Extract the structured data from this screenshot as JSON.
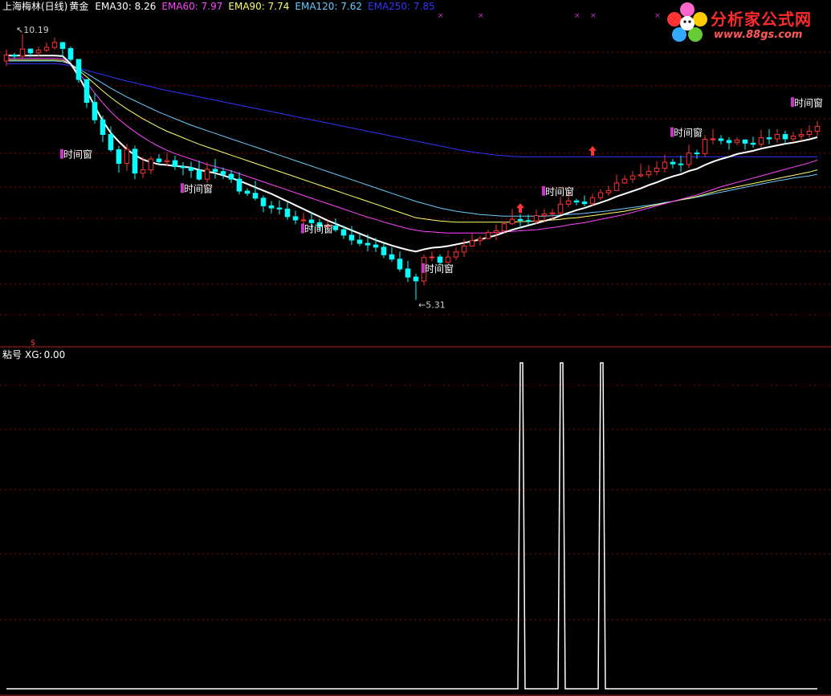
{
  "chart_data": [
    {
      "type": "candlestick",
      "header": {
        "title": "上海梅林(日线)",
        "indicator_name": "黄金",
        "ema_labels": [
          {
            "label": "EMA30:",
            "value": "8.26",
            "color": "#ffffff"
          },
          {
            "label": "EMA60:",
            "value": "7.97",
            "color": "#ff44ff"
          },
          {
            "label": "EMA90:",
            "value": "7.74",
            "color": "#ffff66"
          },
          {
            "label": "EMA120:",
            "value": "7.62",
            "color": "#66ccff"
          },
          {
            "label": "EMA250:",
            "value": "7.85",
            "color": "#3333ff"
          }
        ]
      },
      "ylim": [
        4.7,
        10.6
      ],
      "high_label": "10.19",
      "low_label": "←5.31",
      "signal_label": "时间窗",
      "signals": [
        {
          "i": 7,
          "y": 7.95
        },
        {
          "i": 22,
          "y": 7.32
        },
        {
          "i": 37,
          "y": 6.58
        },
        {
          "i": 52,
          "y": 5.85
        },
        {
          "i": 67,
          "y": 7.27
        },
        {
          "i": 83,
          "y": 8.35
        },
        {
          "i": 98,
          "y": 8.9
        }
      ],
      "up_arrows": [
        {
          "i": 64,
          "y": 7.0
        },
        {
          "i": 73,
          "y": 8.05
        }
      ],
      "x_marks": [
        54,
        59,
        71,
        73,
        81
      ],
      "candles": {
        "o": [
          9.7,
          9.81,
          9.79,
          9.92,
          9.85,
          9.9,
          9.95,
          10.04,
          9.93,
          9.73,
          9.36,
          8.94,
          8.62,
          8.35,
          8.07,
          7.82,
          8.08,
          7.64,
          7.7,
          7.9,
          7.85,
          7.87,
          7.76,
          7.74,
          7.69,
          7.53,
          7.71,
          7.67,
          7.62,
          7.53,
          7.31,
          7.27,
          7.18,
          7.04,
          7.0,
          6.98,
          6.84,
          6.78,
          6.78,
          6.73,
          6.66,
          6.67,
          6.6,
          6.5,
          6.41,
          6.35,
          6.32,
          6.28,
          6.14,
          6.06,
          5.88,
          5.73,
          5.66,
          6.09,
          6.1,
          6.0,
          6.1,
          6.19,
          6.3,
          6.4,
          6.44,
          6.55,
          6.58,
          6.71,
          6.79,
          6.77,
          6.76,
          6.86,
          6.89,
          6.91,
          7.07,
          7.13,
          7.11,
          7.08,
          7.19,
          7.28,
          7.32,
          7.46,
          7.53,
          7.59,
          7.61,
          7.67,
          7.73,
          7.84,
          7.81,
          7.8,
          8.01,
          8.0,
          8.26,
          8.27,
          8.24,
          8.2,
          8.25,
          8.19,
          8.17,
          8.29,
          8.27,
          8.35,
          8.27,
          8.32,
          8.35,
          8.41
        ],
        "c": [
          9.81,
          9.79,
          9.92,
          9.85,
          9.9,
          9.95,
          10.04,
          9.93,
          9.73,
          9.36,
          8.94,
          8.62,
          8.35,
          8.07,
          7.82,
          8.08,
          7.64,
          7.7,
          7.9,
          7.85,
          7.87,
          7.76,
          7.74,
          7.69,
          7.53,
          7.71,
          7.67,
          7.62,
          7.53,
          7.31,
          7.27,
          7.18,
          7.04,
          7.0,
          6.98,
          6.84,
          6.78,
          6.78,
          6.73,
          6.66,
          6.67,
          6.6,
          6.5,
          6.41,
          6.35,
          6.32,
          6.28,
          6.14,
          6.06,
          5.88,
          5.73,
          5.66,
          6.09,
          6.1,
          6.0,
          6.1,
          6.19,
          6.3,
          6.4,
          6.44,
          6.55,
          6.58,
          6.71,
          6.79,
          6.77,
          6.76,
          6.86,
          6.89,
          6.91,
          7.07,
          7.13,
          7.11,
          7.08,
          7.19,
          7.28,
          7.32,
          7.46,
          7.53,
          7.59,
          7.61,
          7.67,
          7.73,
          7.84,
          7.81,
          7.8,
          8.01,
          8.0,
          8.26,
          8.27,
          8.24,
          8.2,
          8.25,
          8.19,
          8.17,
          8.29,
          8.27,
          8.35,
          8.27,
          8.32,
          8.35,
          8.41,
          8.5
        ],
        "h": [
          9.91,
          9.85,
          10.19,
          9.91,
          9.96,
          10.04,
          10.13,
          10.01,
          9.97,
          9.64,
          9.2,
          9.1,
          8.7,
          8.5,
          8.14,
          8.18,
          8.15,
          7.94,
          7.95,
          7.99,
          8.02,
          7.96,
          7.84,
          7.85,
          7.87,
          7.84,
          7.9,
          7.74,
          7.7,
          7.66,
          7.36,
          7.5,
          7.23,
          7.13,
          7.14,
          7.1,
          6.95,
          6.91,
          6.92,
          6.8,
          6.77,
          6.81,
          6.68,
          6.67,
          6.53,
          6.52,
          6.45,
          6.36,
          6.28,
          6.2,
          6.03,
          5.79,
          6.15,
          6.2,
          6.15,
          6.22,
          6.27,
          6.43,
          6.53,
          6.49,
          6.6,
          6.7,
          6.75,
          6.98,
          6.89,
          6.88,
          6.97,
          6.98,
          6.98,
          7.2,
          7.31,
          7.17,
          7.23,
          7.26,
          7.35,
          7.41,
          7.61,
          7.6,
          7.68,
          7.81,
          7.79,
          7.86,
          7.98,
          7.9,
          7.96,
          8.16,
          8.07,
          8.34,
          8.45,
          8.34,
          8.3,
          8.3,
          8.26,
          8.31,
          8.43,
          8.45,
          8.45,
          8.42,
          8.4,
          8.46,
          8.52,
          8.6
        ],
        "l": [
          9.61,
          9.74,
          9.75,
          9.78,
          9.78,
          9.86,
          9.91,
          9.77,
          9.69,
          9.3,
          8.84,
          8.55,
          8.21,
          8.03,
          7.65,
          7.68,
          7.53,
          7.55,
          7.62,
          7.79,
          7.77,
          7.7,
          7.6,
          7.55,
          7.5,
          7.46,
          7.54,
          7.53,
          7.46,
          7.25,
          7.22,
          7.14,
          6.92,
          6.9,
          6.88,
          6.78,
          6.7,
          6.69,
          6.6,
          6.59,
          6.6,
          6.56,
          6.43,
          6.32,
          6.3,
          6.2,
          6.19,
          6.08,
          6.01,
          5.83,
          5.64,
          5.31,
          5.58,
          6.02,
          5.96,
          5.98,
          6.04,
          6.1,
          6.29,
          6.31,
          6.42,
          6.41,
          6.54,
          6.69,
          6.63,
          6.68,
          6.7,
          6.74,
          6.78,
          6.87,
          7.01,
          7.05,
          7.03,
          7.04,
          7.14,
          7.22,
          7.37,
          7.44,
          7.46,
          7.56,
          7.55,
          7.6,
          7.65,
          7.73,
          7.66,
          7.73,
          7.9,
          7.94,
          8.17,
          8.17,
          8.07,
          8.15,
          8.07,
          8.11,
          8.12,
          8.17,
          8.2,
          8.17,
          8.21,
          8.23,
          8.29,
          8.32
        ]
      },
      "ema": [
        {
          "name": "EMA30",
          "color": "#ffffff",
          "width": 2,
          "values": [
            9.8,
            9.8,
            9.8,
            9.8,
            9.8,
            9.8,
            9.8,
            9.79,
            9.65,
            9.42,
            9.15,
            8.87,
            8.6,
            8.38,
            8.22,
            8.08,
            7.97,
            7.89,
            7.84,
            7.8,
            7.79,
            7.77,
            7.76,
            7.74,
            7.7,
            7.67,
            7.64,
            7.6,
            7.55,
            7.5,
            7.44,
            7.38,
            7.32,
            7.26,
            7.19,
            7.12,
            7.05,
            6.98,
            6.91,
            6.84,
            6.77,
            6.71,
            6.65,
            6.59,
            6.53,
            6.47,
            6.41,
            6.36,
            6.31,
            6.27,
            6.23,
            6.2,
            6.24,
            6.27,
            6.28,
            6.3,
            6.33,
            6.36,
            6.39,
            6.42,
            6.46,
            6.5,
            6.55,
            6.6,
            6.64,
            6.68,
            6.72,
            6.76,
            6.8,
            6.86,
            6.91,
            6.96,
            7.0,
            7.05,
            7.1,
            7.15,
            7.21,
            7.26,
            7.31,
            7.36,
            7.42,
            7.47,
            7.53,
            7.58,
            7.62,
            7.68,
            7.72,
            7.79,
            7.85,
            7.9,
            7.94,
            7.99,
            8.02,
            8.05,
            8.09,
            8.12,
            8.15,
            8.18,
            8.2,
            8.23,
            8.26,
            8.3
          ]
        },
        {
          "name": "EMA60",
          "color": "#ff44ff",
          "width": 1,
          "values": [
            9.75,
            9.75,
            9.75,
            9.75,
            9.75,
            9.75,
            9.75,
            9.74,
            9.64,
            9.48,
            9.3,
            9.11,
            8.93,
            8.77,
            8.63,
            8.51,
            8.4,
            8.3,
            8.21,
            8.13,
            8.06,
            8.0,
            7.95,
            7.9,
            7.85,
            7.8,
            7.76,
            7.72,
            7.68,
            7.63,
            7.58,
            7.53,
            7.48,
            7.43,
            7.38,
            7.33,
            7.28,
            7.23,
            7.18,
            7.13,
            7.08,
            7.03,
            6.98,
            6.93,
            6.88,
            6.83,
            6.79,
            6.74,
            6.7,
            6.66,
            6.62,
            6.59,
            6.57,
            6.56,
            6.55,
            6.54,
            6.54,
            6.54,
            6.54,
            6.54,
            6.54,
            6.55,
            6.56,
            6.57,
            6.58,
            6.59,
            6.6,
            6.62,
            6.64,
            6.66,
            6.69,
            6.71,
            6.73,
            6.76,
            6.79,
            6.82,
            6.85,
            6.88,
            6.92,
            6.96,
            7.0,
            7.04,
            7.08,
            7.12,
            7.16,
            7.2,
            7.24,
            7.29,
            7.34,
            7.39,
            7.43,
            7.47,
            7.51,
            7.55,
            7.59,
            7.63,
            7.67,
            7.71,
            7.75,
            7.79,
            7.83,
            7.88
          ]
        },
        {
          "name": "EMA90",
          "color": "#ffff66",
          "width": 1,
          "values": [
            9.72,
            9.72,
            9.72,
            9.72,
            9.72,
            9.72,
            9.72,
            9.71,
            9.64,
            9.53,
            9.41,
            9.28,
            9.15,
            9.03,
            8.92,
            8.82,
            8.73,
            8.64,
            8.56,
            8.48,
            8.41,
            8.35,
            8.29,
            8.23,
            8.17,
            8.12,
            8.07,
            8.02,
            7.97,
            7.92,
            7.87,
            7.82,
            7.77,
            7.72,
            7.67,
            7.62,
            7.57,
            7.52,
            7.47,
            7.42,
            7.37,
            7.32,
            7.27,
            7.22,
            7.17,
            7.12,
            7.07,
            7.02,
            6.97,
            6.92,
            6.87,
            6.82,
            6.8,
            6.78,
            6.76,
            6.75,
            6.74,
            6.74,
            6.74,
            6.74,
            6.74,
            6.74,
            6.74,
            6.74,
            6.75,
            6.75,
            6.76,
            6.77,
            6.78,
            6.79,
            6.81,
            6.82,
            6.84,
            6.86,
            6.88,
            6.9,
            6.92,
            6.94,
            6.97,
            7.0,
            7.03,
            7.06,
            7.09,
            7.12,
            7.15,
            7.18,
            7.21,
            7.25,
            7.29,
            7.33,
            7.36,
            7.39,
            7.42,
            7.45,
            7.48,
            7.51,
            7.54,
            7.57,
            7.6,
            7.63,
            7.66,
            7.7
          ]
        },
        {
          "name": "EMA120",
          "color": "#66ccff",
          "width": 1,
          "values": [
            9.7,
            9.7,
            9.7,
            9.7,
            9.7,
            9.7,
            9.7,
            9.69,
            9.64,
            9.56,
            9.47,
            9.38,
            9.29,
            9.2,
            9.12,
            9.04,
            8.97,
            8.9,
            8.83,
            8.76,
            8.7,
            8.64,
            8.58,
            8.52,
            8.47,
            8.42,
            8.37,
            8.32,
            8.27,
            8.22,
            8.17,
            8.12,
            8.07,
            8.02,
            7.97,
            7.92,
            7.87,
            7.82,
            7.77,
            7.72,
            7.67,
            7.62,
            7.57,
            7.52,
            7.47,
            7.42,
            7.37,
            7.32,
            7.27,
            7.22,
            7.17,
            7.12,
            7.08,
            7.04,
            7.0,
            6.97,
            6.94,
            6.92,
            6.9,
            6.88,
            6.87,
            6.86,
            6.85,
            6.85,
            6.85,
            6.85,
            6.85,
            6.85,
            6.86,
            6.87,
            6.88,
            6.89,
            6.9,
            6.92,
            6.93,
            6.95,
            6.97,
            6.99,
            7.01,
            7.03,
            7.05,
            7.07,
            7.1,
            7.12,
            7.15,
            7.17,
            7.2,
            7.23,
            7.26,
            7.29,
            7.32,
            7.35,
            7.38,
            7.41,
            7.44,
            7.47,
            7.5,
            7.52,
            7.55,
            7.57,
            7.59,
            7.62
          ]
        },
        {
          "name": "EMA250",
          "color": "#3333ff",
          "width": 1,
          "values": [
            9.65,
            9.65,
            9.65,
            9.65,
            9.65,
            9.65,
            9.65,
            9.64,
            9.61,
            9.57,
            9.53,
            9.49,
            9.45,
            9.41,
            9.37,
            9.33,
            9.3,
            9.26,
            9.23,
            9.19,
            9.16,
            9.13,
            9.1,
            9.07,
            9.04,
            9.01,
            8.98,
            8.95,
            8.92,
            8.89,
            8.86,
            8.83,
            8.8,
            8.77,
            8.74,
            8.71,
            8.68,
            8.65,
            8.62,
            8.59,
            8.56,
            8.53,
            8.5,
            8.47,
            8.44,
            8.41,
            8.38,
            8.35,
            8.32,
            8.29,
            8.26,
            8.23,
            8.2,
            8.17,
            8.14,
            8.11,
            8.08,
            8.05,
            8.03,
            8.01,
            7.99,
            7.97,
            7.96,
            7.95,
            7.94,
            7.94,
            7.94,
            7.94,
            7.94,
            7.94,
            7.94,
            7.94,
            7.94,
            7.94,
            7.94,
            7.94,
            7.94,
            7.94,
            7.94,
            7.94,
            7.94,
            7.94,
            7.94,
            7.94,
            7.94,
            7.94,
            7.94,
            7.94,
            7.94,
            7.94,
            7.94,
            7.94,
            7.94,
            7.94,
            7.94,
            7.94,
            7.94,
            7.94,
            7.94,
            7.94,
            7.94,
            7.94
          ]
        }
      ]
    },
    {
      "type": "line",
      "header": {
        "title": "粘号",
        "value_label": "XG:",
        "value": "0.00"
      },
      "ylim": [
        0,
        1
      ],
      "values": [
        0,
        0,
        0,
        0,
        0,
        0,
        0,
        0,
        0,
        0,
        0,
        0,
        0,
        0,
        0,
        0,
        0,
        0,
        0,
        0,
        0,
        0,
        0,
        0,
        0,
        0,
        0,
        0,
        0,
        0,
        0,
        0,
        0,
        0,
        0,
        0,
        0,
        0,
        0,
        0,
        0,
        0,
        0,
        0,
        0,
        0,
        0,
        0,
        0,
        0,
        0,
        0,
        0,
        0,
        0,
        0,
        0,
        0,
        0,
        0,
        0,
        0,
        0,
        0,
        1,
        0,
        0,
        0,
        0,
        1,
        0,
        0,
        0,
        0,
        1,
        0,
        0,
        0,
        0,
        0,
        0,
        0,
        0,
        0,
        0,
        0,
        0,
        0,
        0,
        0,
        0,
        0,
        0,
        0,
        0,
        0,
        0,
        0,
        0,
        0,
        0,
        0
      ],
      "color": "#ffffff"
    }
  ],
  "colors": {
    "up": "#ff3333",
    "down": "#00ffff",
    "grid": "#8b0000",
    "signal_box": "#cc33cc",
    "arrow": "#ff3333",
    "x_mark": "#cc33cc"
  },
  "watermark": {
    "text": "分析家公式网",
    "url": "www.88gs.com"
  }
}
